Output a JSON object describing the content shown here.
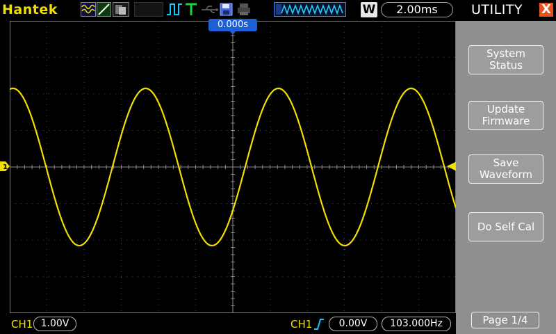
{
  "header": {
    "brand": "Hantek",
    "timebase_mode": "W",
    "timebase": "2.00ms"
  },
  "scope": {
    "trigger_position": "0.000s",
    "channel_marker": "1",
    "waveform_color": "#f0e000",
    "grid_color": "#5a5a5a"
  },
  "footer": {
    "ch1_label": "CH1",
    "ch1_scale": "1.00V",
    "trigger_source": "CH1",
    "trigger_level": "0.00V",
    "frequency": "103.000Hz"
  },
  "menu": {
    "title": "UTILITY",
    "close_glyph": "X",
    "items": [
      {
        "label": "System\nStatus"
      },
      {
        "label": "Update\nFirmware"
      },
      {
        "label": "Save\nWaveform"
      },
      {
        "label": "Do Self Cal"
      }
    ],
    "page_label": "Page 1/4"
  },
  "colors": {
    "accent_yellow": "#f0e000",
    "accent_blue": "#1e5fd6",
    "menu_bg": "#8f8f8f",
    "close_orange": "#e8531c"
  }
}
